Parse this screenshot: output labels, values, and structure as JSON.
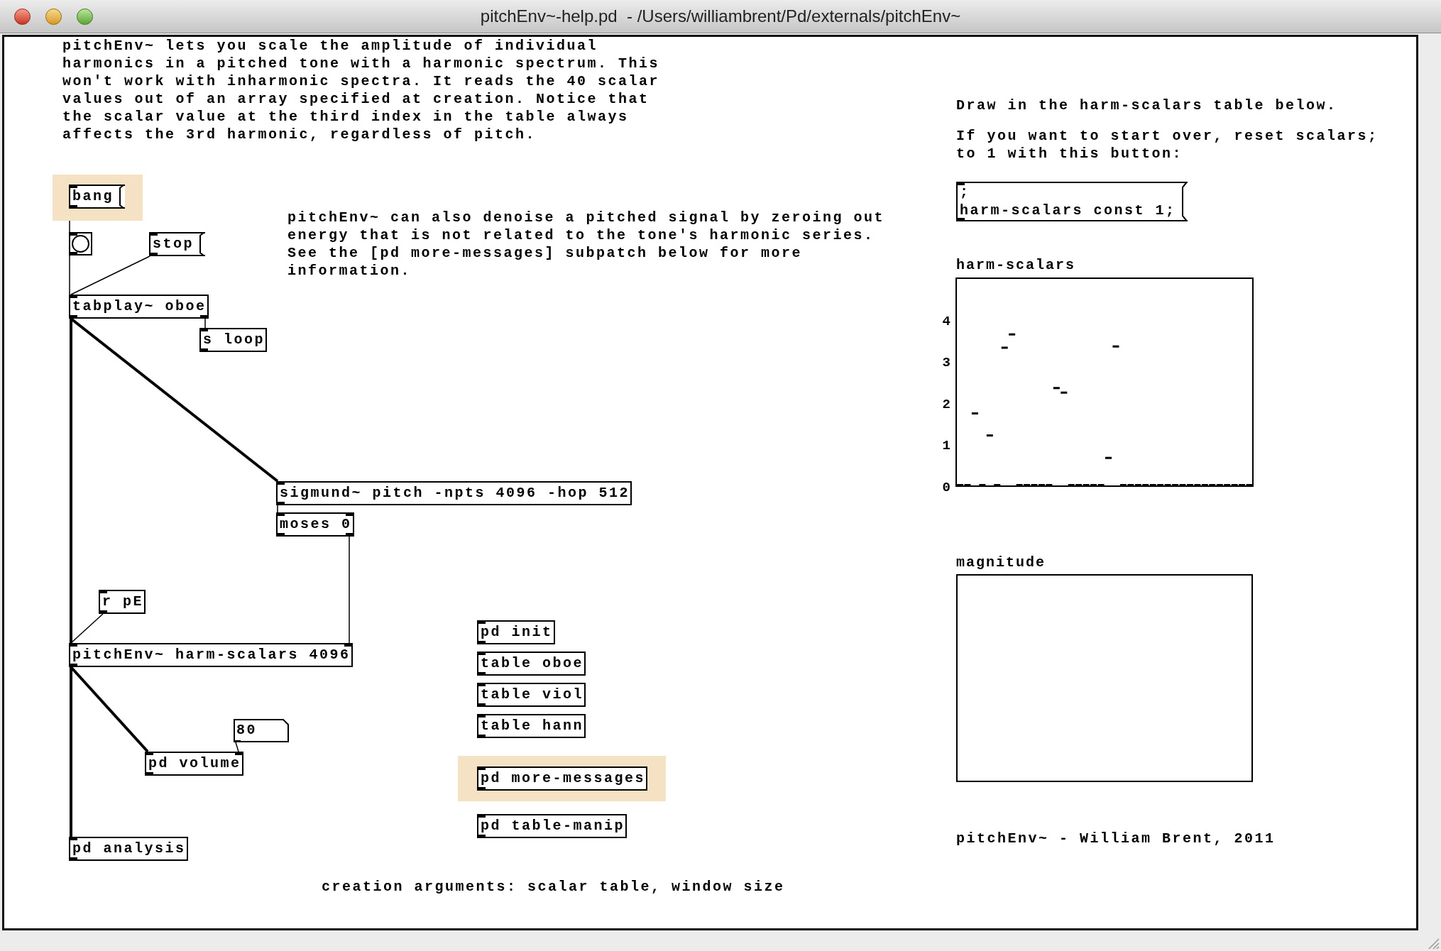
{
  "window": {
    "title": "pitchEnv~-help.pd  - /Users/williambrent/Pd/externals/pitchEnv~"
  },
  "comments": [
    {
      "text": "pitchEnv~ lets you scale the amplitude of individual harmonics in a pitched tone with a harmonic spectrum. This won't work with inharmonic spectra. It reads the 40 scalar values out of an array specified at creation. Notice that the scalar value at the third index in the table always affects the 3rd harmonic, regardless of pitch."
    },
    {
      "text": "Draw in the harm-scalars table below."
    },
    {
      "text": "If you want to start over, reset scalars; to 1 with this button:"
    },
    {
      "text": "pitchEnv~ can also denoise a pitched signal by zeroing out energy that is not related to the tone's harmonic series. See the [pd more-messages] subpatch below for more information."
    },
    {
      "text": "pitchEnv~ - William Brent, 2011"
    },
    {
      "text": "creation arguments: scalar table, window size"
    }
  ],
  "objects": [
    {
      "kind": "message",
      "text": "bang",
      "highlighted": true
    },
    {
      "kind": "bang"
    },
    {
      "kind": "message",
      "text": "stop"
    },
    {
      "kind": "object",
      "text": "tabplay~ oboe"
    },
    {
      "kind": "object",
      "text": "s loop"
    },
    {
      "kind": "message",
      "text": ";\nharm-scalars const 1;"
    },
    {
      "kind": "object",
      "text": "sigmund~ pitch -npts 4096 -hop 512"
    },
    {
      "kind": "object",
      "text": "moses 0"
    },
    {
      "kind": "object",
      "text": "r pE"
    },
    {
      "kind": "object",
      "text": "pd init"
    },
    {
      "kind": "object",
      "text": "pitchEnv~ harm-scalars 4096"
    },
    {
      "kind": "object",
      "text": "table oboe"
    },
    {
      "kind": "object",
      "text": "table viol"
    },
    {
      "kind": "number",
      "text": "80"
    },
    {
      "kind": "object",
      "text": "table hann"
    },
    {
      "kind": "object",
      "text": "pd volume"
    },
    {
      "kind": "object",
      "text": "pd more-messages",
      "highlighted": true
    },
    {
      "kind": "object",
      "text": "pd table-manip"
    },
    {
      "kind": "object",
      "text": "pd analysis"
    }
  ],
  "graphs": [
    {
      "label": "harm-scalars",
      "kind": "points",
      "axis_labels": [
        "4",
        "3",
        "2",
        "1",
        "0"
      ]
    },
    {
      "label": "magnitude"
    }
  ]
}
